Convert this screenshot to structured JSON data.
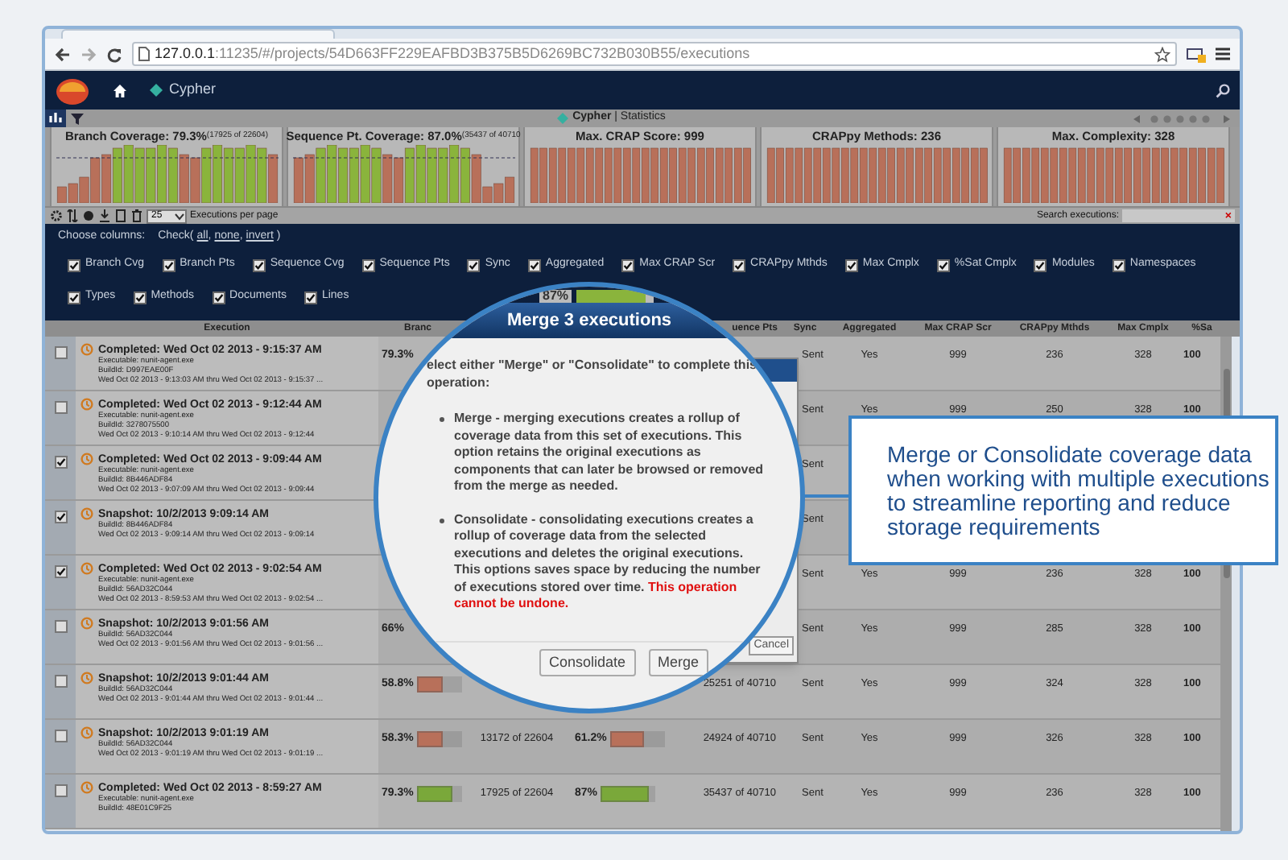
{
  "browser": {
    "url_host": "127.0.0.1",
    "url_path": ":11235/#/projects/54D663FF229EAFBD3B375B5D6269BC732B030B55/executions"
  },
  "app_header": {
    "breadcrumb": "Cypher"
  },
  "stats_bar": {
    "title": "**Cypher** | Statistics"
  },
  "stat_panels": [
    {
      "title": "Branch Coverage: 79.3%",
      "detail": "(17925 of 22604)",
      "kind": "mixed"
    },
    {
      "title": "Sequence Pt. Coverage: 87.0%",
      "detail": "(35437 of 40710",
      "kind": "mixed"
    },
    {
      "title": "Max. CRAP Score: 999",
      "kind": "uniform"
    },
    {
      "title": "CRAPpy Methods: 236",
      "kind": "uniform"
    },
    {
      "title": "Max. Complexity: 328",
      "kind": "uniform"
    }
  ],
  "toolbar": {
    "page_size": "25",
    "page_size_label": "Executions per page",
    "search_label": "Search executions:",
    "clear": "×"
  },
  "column_chooser": {
    "label": "Choose columns:",
    "check_open": "Check(",
    "links": [
      {
        "label": "all",
        "separator": ","
      },
      {
        "label": "none",
        "separator": ","
      },
      {
        "label": "invert"
      }
    ],
    "check_close": ")",
    "columns": [
      {
        "label": "Branch Cvg",
        "checked": true
      },
      {
        "label": "Branch Pts",
        "checked": true
      },
      {
        "label": "Sequence Cvg",
        "checked": true
      },
      {
        "label": "Sequence Pts",
        "checked": true
      },
      {
        "label": "Sync",
        "checked": true
      },
      {
        "label": "Aggregated",
        "checked": true
      },
      {
        "label": "Max CRAP Scr",
        "checked": true
      },
      {
        "label": "CRAPpy Mthds",
        "checked": true
      },
      {
        "label": "Max Cmplx",
        "checked": true
      },
      {
        "label": "%Sat Cmplx",
        "checked": true
      },
      {
        "label": "Modules",
        "checked": true
      },
      {
        "label": "Namespaces",
        "checked": true
      },
      {
        "label": "Types",
        "checked": true
      },
      {
        "label": "Methods",
        "checked": true
      },
      {
        "label": "Documents",
        "checked": true
      },
      {
        "label": "Lines",
        "checked": true
      }
    ]
  },
  "table": {
    "headers": {
      "execution": "Execution",
      "branch": "Branc",
      "seq_pts": "uence Pts",
      "sync": "Sync",
      "aggregated": "Aggregated",
      "max_crap": "Max CRAP Scr",
      "crappy": "CRAPpy Mthds",
      "max_cmplx": "Max Cmplx",
      "sat": "%Sa"
    },
    "rows": [
      {
        "checked": false,
        "title": "Completed: Wed Oct 02 2013 - 9:15:37 AM",
        "executable": "Executable: nunit-agent.exe",
        "build": "BuildId: D997EAE00F",
        "range": "Wed Oct 02 2013 - 9:13:03 AM thru Wed Oct 02 2013 - 9:15:37 ...",
        "branch_cvg": "79.3%",
        "sync": "Sent",
        "aggregated": "Yes",
        "max_crap": "999",
        "crappy": "236",
        "max_cmplx": "328",
        "sat": "100"
      },
      {
        "checked": false,
        "title": "Completed: Wed Oct 02 2013 - 9:12:44 AM",
        "executable": "Executable: nunit-agent.exe",
        "build": "BuildId: 3278075500",
        "range": "Wed Oct 02 2013 - 9:10:14 AM thru Wed Oct 02 2013 - 9:12:44",
        "sync": "Sent",
        "aggregated": "Yes",
        "max_crap": "999",
        "crappy": "250",
        "max_cmplx": "328",
        "sat": "100"
      },
      {
        "checked": true,
        "title": "Completed: Wed Oct 02 2013 - 9:09:44 AM",
        "executable": "Executable: nunit-agent.exe",
        "build": "BuildId: 8B446ADF84",
        "range": "Wed Oct 02 2013 - 9:07:09 AM thru Wed Oct 02 2013 - 9:09:44",
        "sync": "Sent"
      },
      {
        "checked": true,
        "title": "Snapshot: 10/2/2013 9:09:14 AM",
        "build": "BuildId: 8B446ADF84",
        "range": "Wed Oct 02 2013 - 9:09:14 AM thru Wed Oct 02 2013 - 9:09:14",
        "sync": "Sent"
      },
      {
        "checked": true,
        "title": "Completed: Wed Oct 02 2013 - 9:02:54 AM",
        "executable": "Executable: nunit-agent.exe",
        "build": "BuildId: 56AD32C044",
        "range": "Wed Oct 02 2013 - 8:59:53 AM thru Wed Oct 02 2013 - 9:02:54 ...",
        "sync": "Sent",
        "aggregated": "Yes",
        "max_crap": "999",
        "crappy": "236",
        "max_cmplx": "328",
        "sat": "100"
      },
      {
        "checked": false,
        "title": "Snapshot: 10/2/2013 9:01:56 AM",
        "build": "BuildId: 56AD32C044",
        "range": "Wed Oct 02 2013 - 9:01:56 AM thru Wed Oct 02 2013 - 9:01:56 ...",
        "branch_cvg": "66%",
        "sync": "Sent",
        "aggregated": "Yes",
        "max_crap": "999",
        "crappy": "285",
        "max_cmplx": "328",
        "sat": "100"
      },
      {
        "checked": false,
        "title": "Snapshot: 10/2/2013 9:01:44 AM",
        "build": "BuildId: 56AD32C044",
        "range": "Wed Oct 02 2013 - 9:01:44 AM thru Wed Oct 02 2013 - 9:01:44 ...",
        "branch_cvg": "58.8%",
        "branch_bar": {
          "level": 0.59,
          "color": "#b8705a"
        },
        "seq_pts": "25251 of 40710",
        "sync": "Sent",
        "aggregated": "Yes",
        "max_crap": "999",
        "crappy": "324",
        "max_cmplx": "328",
        "sat": "100"
      },
      {
        "checked": false,
        "title": "Snapshot: 10/2/2013 9:01:19 AM",
        "build": "BuildId: 56AD32C044",
        "range": "Wed Oct 02 2013 - 9:01:19 AM thru Wed Oct 02 2013 - 9:01:19 ...",
        "branch_cvg": "58.3%",
        "branch_bar": {
          "level": 0.58,
          "color": "#b8705a"
        },
        "branch_pts": "13172 of 22604",
        "seq_cvg": "61.2%",
        "seq_bar": {
          "level": 0.61,
          "color": "#b8705a"
        },
        "seq_pts": "24924 of 40710",
        "sync": "Sent",
        "aggregated": "Yes",
        "max_crap": "999",
        "crappy": "326",
        "max_cmplx": "328",
        "sat": "100"
      },
      {
        "checked": false,
        "title": "Completed: Wed Oct 02 2013 - 8:59:27 AM",
        "executable": "Executable: nunit-agent.exe",
        "build": "BuildId: 48E01C9F25",
        "branch_cvg": "79.3%",
        "branch_bar": {
          "level": 0.79,
          "color": "#7aa83a"
        },
        "branch_pts": "17925 of 22604",
        "seq_cvg": "87%",
        "seq_bar": {
          "level": 0.87,
          "color": "#7aa83a"
        },
        "seq_pts": "35437 of 40710",
        "sync": "Sent",
        "aggregated": "Yes",
        "max_crap": "999",
        "crappy": "236",
        "max_cmplx": "328",
        "sat": "100"
      }
    ]
  },
  "dialog_behind": {
    "cancel": "Cancel"
  },
  "magnifier": {
    "cell_value": "87%",
    "cell_bar": {
      "level": 0.9,
      "color": "#8ab43c"
    },
    "dialog": {
      "title": "Merge 3 executions",
      "intro": "elect either \"Merge\" or \"Consolidate\" to complete this operation:",
      "bullets": [
        "Merge - merging executions creates a rollup of coverage data from this set of executions. This option retains the original executions as components that can later be browsed or removed from the merge as needed.",
        "Consolidate - consolidating executions creates a rollup of coverage data from the selected executions and deletes the original executions. This options saves space by reducing the number of executions stored over time. **This operation cannot be undone.**"
      ],
      "buttons": [
        "Consolidate",
        "Merge"
      ]
    }
  },
  "callout": {
    "text": "Merge or Consolidate coverage data when working with multiple executions to streamline reporting and reduce storage requirements"
  }
}
